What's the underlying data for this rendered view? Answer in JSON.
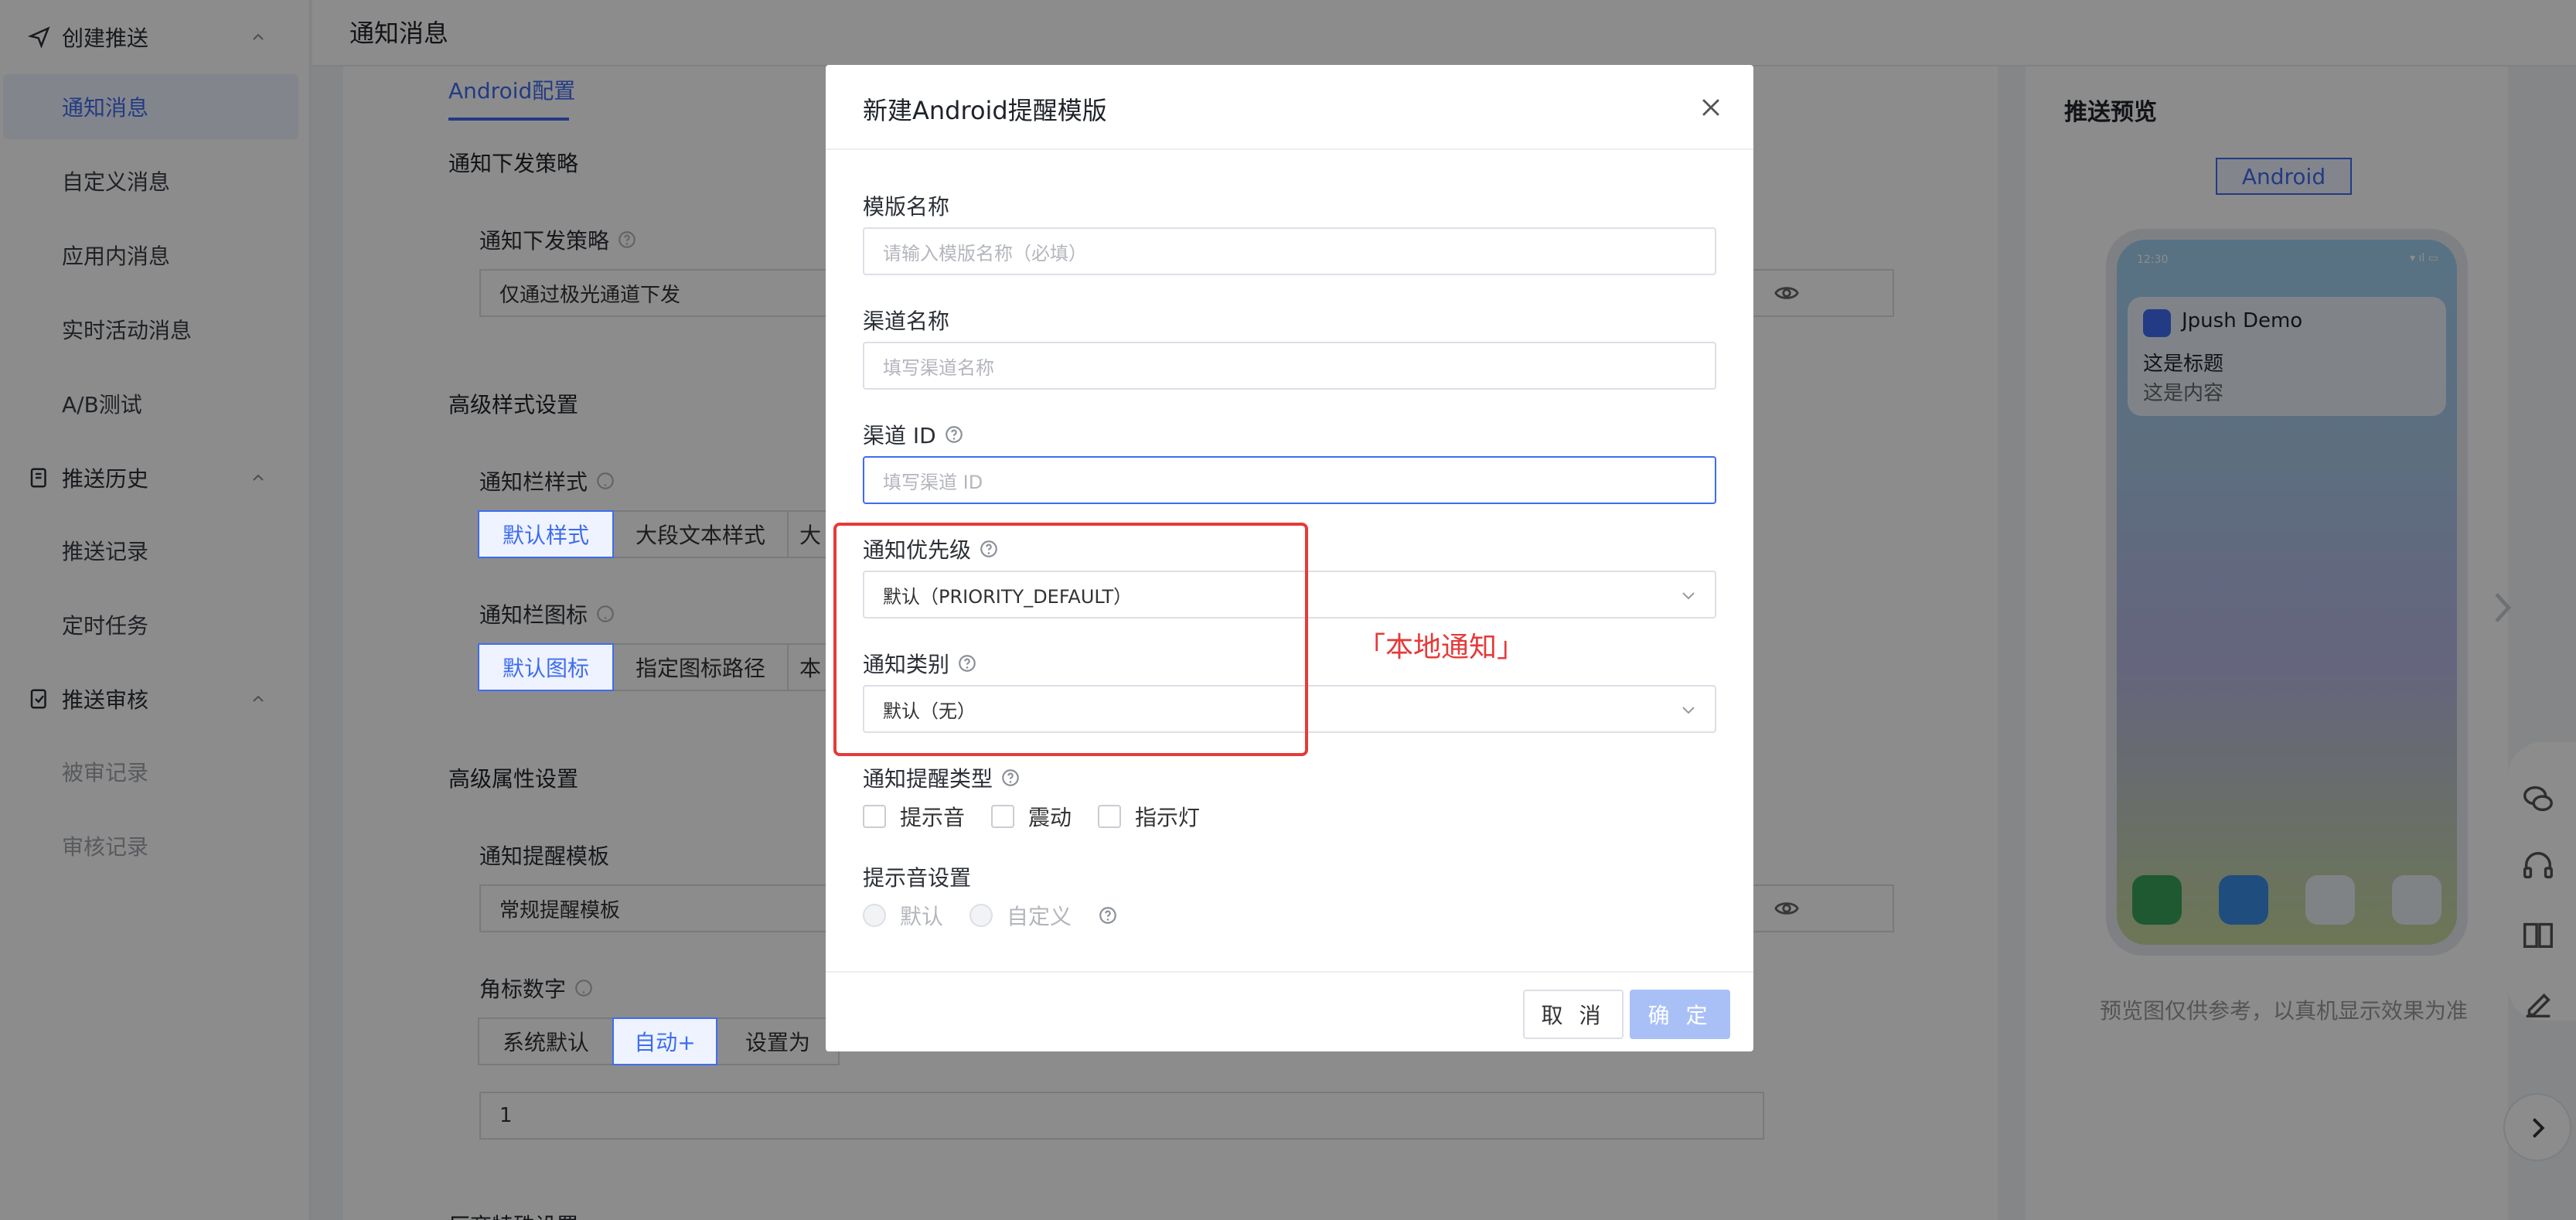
{
  "sidebar": {
    "groups": [
      {
        "label": "创建推送",
        "icon": "send-icon"
      },
      {
        "label": "推送历史",
        "icon": "history-icon"
      },
      {
        "label": "推送审核",
        "icon": "audit-icon"
      }
    ],
    "items": [
      {
        "label": "通知消息",
        "active": true
      },
      {
        "label": "自定义消息"
      },
      {
        "label": "应用内消息"
      },
      {
        "label": "实时活动消息"
      },
      {
        "label": "A/B测试"
      },
      {
        "label": "推送记录"
      },
      {
        "label": "定时任务"
      },
      {
        "label": "被审记录",
        "muted": true
      },
      {
        "label": "审核记录",
        "muted": true
      }
    ]
  },
  "header": {
    "title": "通知消息"
  },
  "main": {
    "tab": "Android配置",
    "strategy_section": "通知下发策略",
    "strategy_label": "通知下发策略",
    "strategy_value": "仅通过极光通道下发",
    "style_section": "高级样式设置",
    "bar_style_label": "通知栏样式",
    "bar_style_options": [
      "默认样式",
      "大段文本样式",
      "大"
    ],
    "bar_icon_label": "通知栏图标",
    "bar_icon_options": [
      "默认图标",
      "指定图标路径",
      "本"
    ],
    "attr_section": "高级属性设置",
    "remind_label": "通知提醒模板",
    "remind_value": "常规提醒模板",
    "badge_label": "角标数字",
    "badge_options": [
      "系统默认",
      "自动+",
      "设置为"
    ],
    "badge_value": "1",
    "vendor_section": "厂商特殊设置"
  },
  "preview": {
    "title": "推送预览",
    "tab": "Android",
    "clock": "12:30",
    "app_name": "Jpush Demo",
    "notif_title": "这是标题",
    "notif_body": "这是内容",
    "note": "预览图仅供参考，以真机显示效果为准"
  },
  "modal": {
    "title": "新建Android提醒模版",
    "template_name_label": "模版名称",
    "template_name_placeholder": "请输入模版名称（必填）",
    "channel_name_label": "渠道名称",
    "channel_name_placeholder": "填写渠道名称",
    "channel_id_label": "渠道 ID",
    "channel_id_placeholder": "填写渠道 ID",
    "priority_label": "通知优先级",
    "priority_value": "默认（PRIORITY_DEFAULT）",
    "category_label": "通知类别",
    "category_value": "默认（无）",
    "remind_type_label": "通知提醒类型",
    "remind_types": [
      "提示音",
      "震动",
      "指示灯"
    ],
    "sound_label": "提示音设置",
    "sound_options": [
      "默认",
      "自定义"
    ],
    "cancel": "取 消",
    "ok": "确 定"
  },
  "annotation": {
    "text": "「本地通知」",
    "color": "#e63a3a"
  },
  "colors": {
    "accent": "#3e6cf0",
    "ok_disabled": "#a9c0f7"
  }
}
